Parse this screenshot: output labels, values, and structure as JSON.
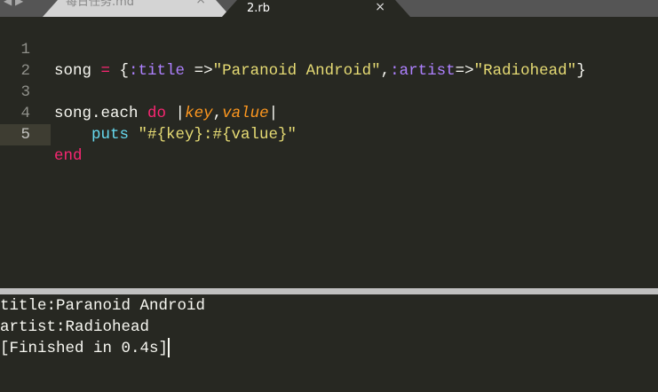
{
  "tabs": [
    {
      "label": "每日任务.md",
      "active": false
    },
    {
      "label": "2.rb",
      "active": true
    }
  ],
  "close_glyph": "×",
  "nav_glyph": "◀ ▶",
  "editor": {
    "line_numbers": [
      "1",
      "2",
      "3",
      "4",
      "5"
    ],
    "line1": {
      "a": "song ",
      "b": "=",
      "c": " {",
      "d": ":title",
      "e": " =>",
      "f": "\"Paranoid Android\"",
      "g": ",",
      "h": ":artist",
      "i": "=>",
      "j": "\"Radiohead\"",
      "k": "}"
    },
    "line3": {
      "a": "song.each ",
      "b": "do",
      "c": " |",
      "d": "key",
      "e": ",",
      "f": "value",
      "g": "|"
    },
    "line4": {
      "a": "    puts ",
      "b": "\"#{key}:#{value}\""
    },
    "line5": {
      "a": "end"
    }
  },
  "output": {
    "lines": [
      "title:Paranoid Android",
      "artist:Radiohead",
      "[Finished in 0.4s]"
    ]
  },
  "colors": {
    "bg": "#272822",
    "keyword": "#f92672",
    "symbol": "#ae81ff",
    "string": "#e6db74",
    "param": "#fd971f"
  }
}
